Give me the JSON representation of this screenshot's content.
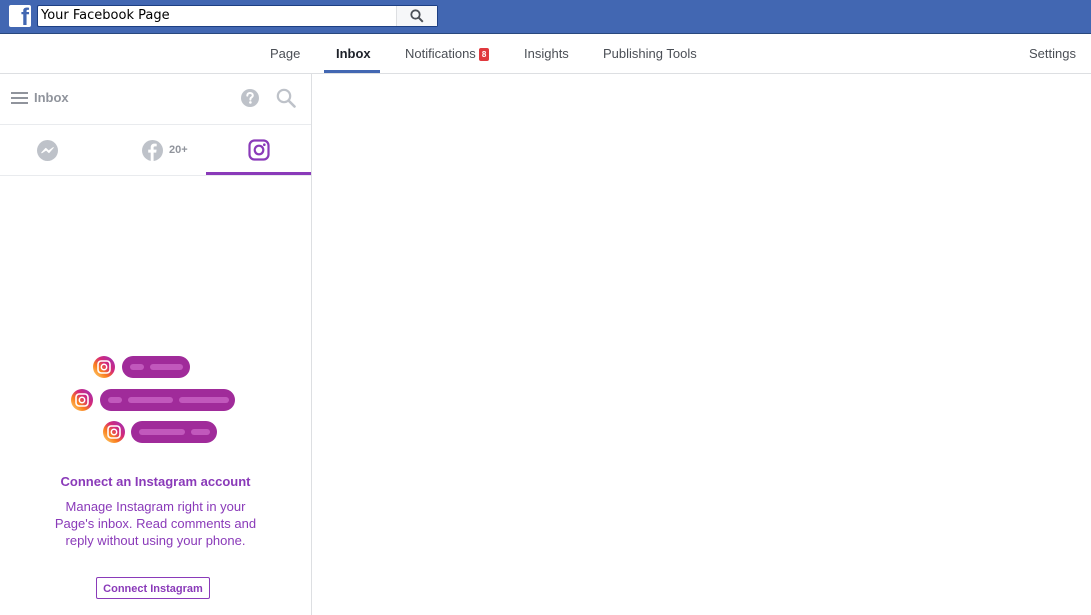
{
  "topbar": {
    "logo_letter": "f",
    "search_value": "Your Facebook Page",
    "icons": {
      "logo": "facebook-logo-icon",
      "search": "search-icon"
    },
    "brand_color": "#4267b2"
  },
  "page_nav": {
    "items": [
      {
        "label": "Page"
      },
      {
        "label": "Inbox",
        "active": true
      },
      {
        "label": "Notifications",
        "badge": "8"
      },
      {
        "label": "Insights"
      },
      {
        "label": "Publishing Tools"
      }
    ],
    "settings_label": "Settings"
  },
  "inbox_panel": {
    "title": "Inbox",
    "icons": {
      "menu": "hamburger-menu-icon",
      "help": "help-question-icon",
      "search": "search-icon"
    },
    "tabs": [
      {
        "icon": "messenger-icon"
      },
      {
        "icon": "facebook-icon",
        "count": "20+"
      },
      {
        "icon": "instagram-icon",
        "active": true
      }
    ],
    "accent_color": "#8a3ab9"
  },
  "connect": {
    "title": "Connect an Instagram account",
    "description": "Manage Instagram right in your Page's inbox. Read comments and reply without using your phone.",
    "button_label": "Connect Instagram"
  }
}
